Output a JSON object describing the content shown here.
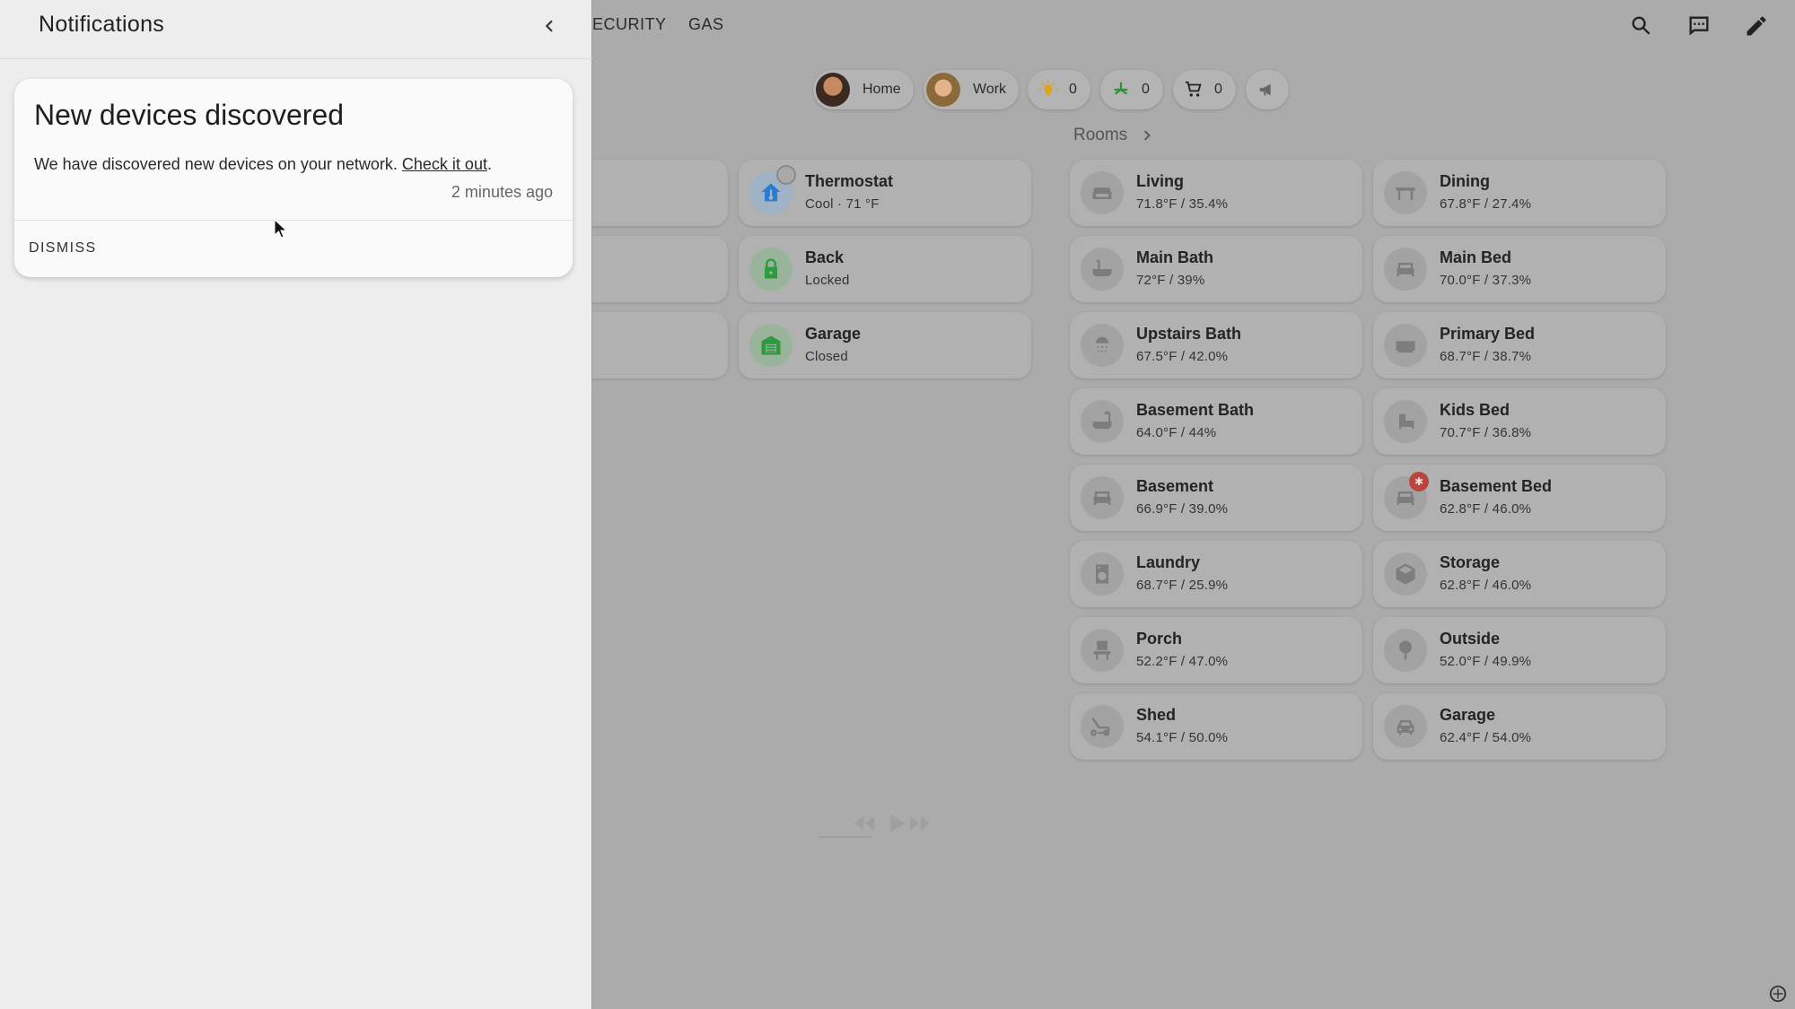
{
  "header": {
    "tabs": [
      "ECURITY",
      "GAS"
    ],
    "icons": [
      "search-icon",
      "assist-icon",
      "edit-icon"
    ]
  },
  "badges": {
    "persons": [
      {
        "name": "Home"
      },
      {
        "name": "Work"
      }
    ],
    "counters": [
      {
        "icon": "lightbulb-icon",
        "count": "0",
        "color": "#e2a316"
      },
      {
        "icon": "fan-icon",
        "count": "0",
        "color": "#2f8f3b"
      },
      {
        "icon": "cart-icon",
        "count": "0",
        "color": "#222222"
      }
    ],
    "announce_icon": "bullhorn-icon"
  },
  "security_cards": [
    {
      "name": "Thermostat",
      "state": "Cool · 71 °F",
      "icon": "thermostat-icon"
    },
    {
      "name": "Back",
      "state": "Locked",
      "icon": "lock-icon"
    },
    {
      "name": "Garage",
      "state": "Closed",
      "icon": "garage-door-icon"
    }
  ],
  "rooms": {
    "title": "Rooms",
    "items": [
      {
        "name": "Living",
        "state": "71.8°F / 35.4%",
        "icon": "sofa-icon"
      },
      {
        "name": "Dining",
        "state": "67.8°F / 27.4%",
        "icon": "table-icon"
      },
      {
        "name": "Main Bath",
        "state": "72°F / 39%",
        "icon": "bathtub-icon"
      },
      {
        "name": "Main Bed",
        "state": "70.0°F / 37.3%",
        "icon": "bed-icon"
      },
      {
        "name": "Upstairs Bath",
        "state": "67.5°F / 42.0%",
        "icon": "shower-icon"
      },
      {
        "name": "Primary Bed",
        "state": "68.7°F / 38.7%",
        "icon": "bed-icon"
      },
      {
        "name": "Basement Bath",
        "state": "64.0°F / 44%",
        "icon": "bathtub-icon"
      },
      {
        "name": "Kids Bed",
        "state": "70.7°F / 36.8%",
        "icon": "bed-icon"
      },
      {
        "name": "Basement",
        "state": "66.9°F / 39.0%",
        "icon": "bed-icon"
      },
      {
        "name": "Basement Bed",
        "state": "62.8°F / 46.0%",
        "icon": "bed-icon"
      },
      {
        "name": "Laundry",
        "state": "68.7°F / 25.9%",
        "icon": "washer-icon"
      },
      {
        "name": "Storage",
        "state": "62.8°F / 46.0%",
        "icon": "box-icon"
      },
      {
        "name": "Porch",
        "state": "52.2°F / 47.0%",
        "icon": "chair-icon"
      },
      {
        "name": "Outside",
        "state": "52.0°F / 49.9%",
        "icon": "tree-icon"
      },
      {
        "name": "Shed",
        "state": "54.1°F / 50.0%",
        "icon": "mower-icon"
      },
      {
        "name": "Garage",
        "state": "62.4°F / 54.0%",
        "icon": "car-icon"
      }
    ]
  },
  "drawer": {
    "title": "Notifications",
    "notification": {
      "title": "New devices discovered",
      "message": "We have discovered new devices on your network.",
      "link": "Check it out",
      "time": "2 minutes ago",
      "dismiss": "DISMISS"
    }
  },
  "colors": {
    "scrim": "#ababab",
    "drawer_bg": "#ededed",
    "card_bg": "#fafafa",
    "lock_green": "#2e9a3e",
    "thermostat_blue": "#2a7bd3",
    "alert_red": "#d9332b"
  }
}
